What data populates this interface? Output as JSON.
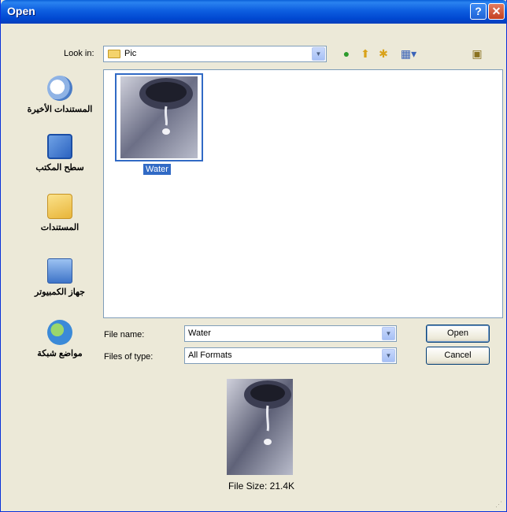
{
  "window": {
    "title": "Open"
  },
  "toolbar": {
    "lookin_label": "Look in:",
    "lookin_value": "Pic"
  },
  "places": [
    {
      "label": "المستندات الأخيرة"
    },
    {
      "label": "سطح المكتب"
    },
    {
      "label": "المستندات"
    },
    {
      "label": "جهاز الكمبيوتر"
    },
    {
      "label": "مواضع شبكة"
    }
  ],
  "files": [
    {
      "name": "Water"
    }
  ],
  "form": {
    "filename_label": "File name:",
    "filename_value": "Water",
    "filetype_label": "Files of type:",
    "filetype_value": "All Formats"
  },
  "buttons": {
    "open": "Open",
    "cancel": "Cancel"
  },
  "preview": {
    "filesize": "File Size: 21.4K"
  },
  "colors": {
    "titlebar": "#0a5fd8",
    "selection": "#316ac5",
    "dialog_bg": "#ece9d8"
  }
}
